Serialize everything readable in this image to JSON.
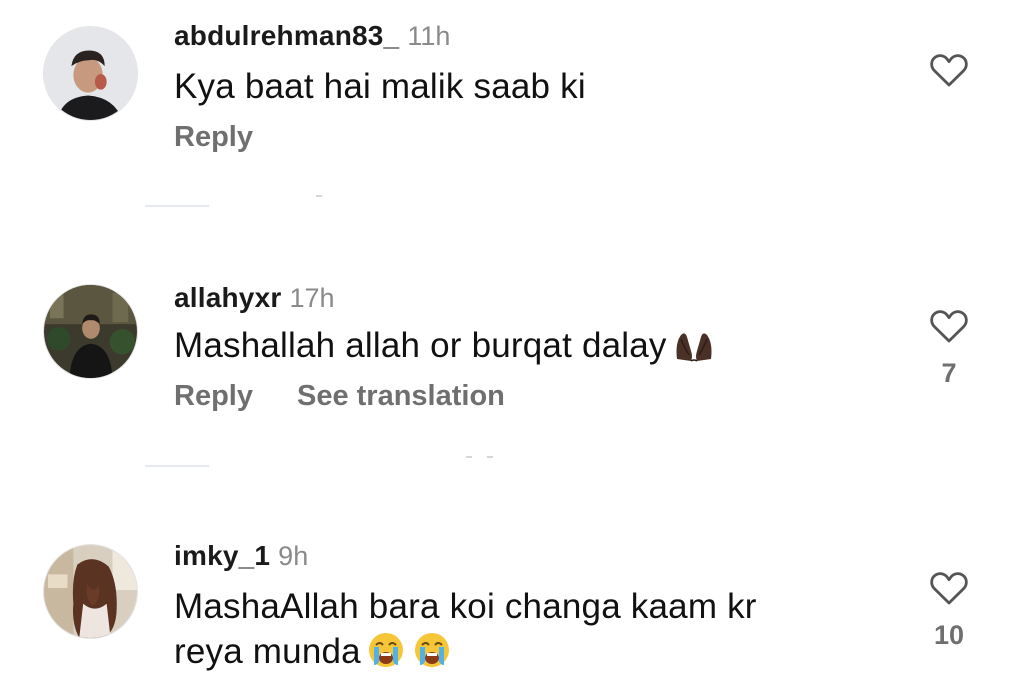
{
  "comments": [
    {
      "username": "abdulrehman83_",
      "time": "11h",
      "text": "Kya baat hai malik saab ki",
      "reply_label": "Reply",
      "avatar_icon": "user-avatar-photo",
      "like_icon": "heart-outline-icon",
      "like_count": ""
    },
    {
      "username": "allahyxr",
      "time": "17h",
      "text": "Mashallah allah or burqat dalay",
      "emoji": "🤲🏿",
      "reply_label": "Reply",
      "translate_label": "See translation",
      "avatar_icon": "user-avatar-photo",
      "like_icon": "heart-outline-icon",
      "like_count": "7"
    },
    {
      "username": "imky_1",
      "time": "9h",
      "text_line1": "MashaAllah bara koi changa kaam kr",
      "text_line2": "reya munda",
      "emoji": "😭😭",
      "avatar_icon": "user-avatar-photo",
      "like_icon": "heart-outline-icon",
      "like_count": "10"
    }
  ],
  "colors": {
    "username": "#1a1a1a",
    "timestamp": "#8a8a8a",
    "action": "#6f6f6f",
    "separator": "#e6eaf0"
  }
}
